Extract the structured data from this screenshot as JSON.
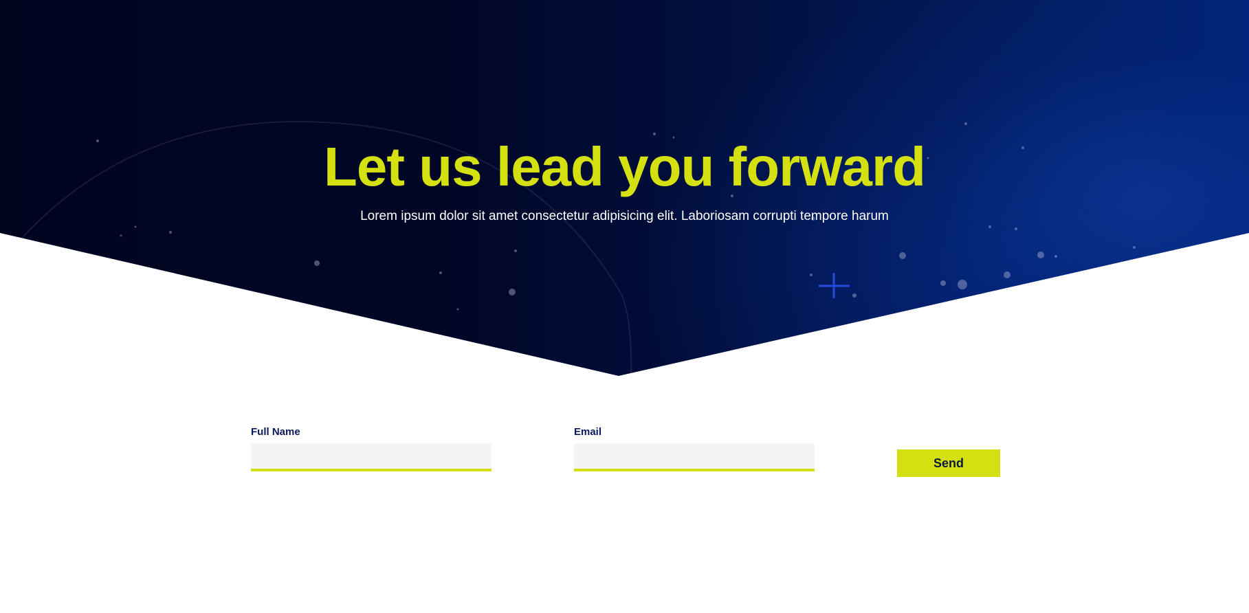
{
  "hero": {
    "title": "Let us lead you forward",
    "subtitle": "Lorem ipsum dolor sit amet consectetur adipisicing elit. Laboriosam corrupti tempore harum"
  },
  "form": {
    "full_name": {
      "label": "Full Name",
      "value": "",
      "placeholder": ""
    },
    "email": {
      "label": "Email",
      "value": "",
      "placeholder": ""
    },
    "send_label": "Send"
  },
  "colors": {
    "accent": "#d4e00f",
    "hero_dark": "#01041f",
    "hero_blue": "#03247a",
    "label_text": "#0a1a5c",
    "input_background": "#f4f4f4"
  },
  "icons": [
    "plus-sparkle-icon"
  ]
}
